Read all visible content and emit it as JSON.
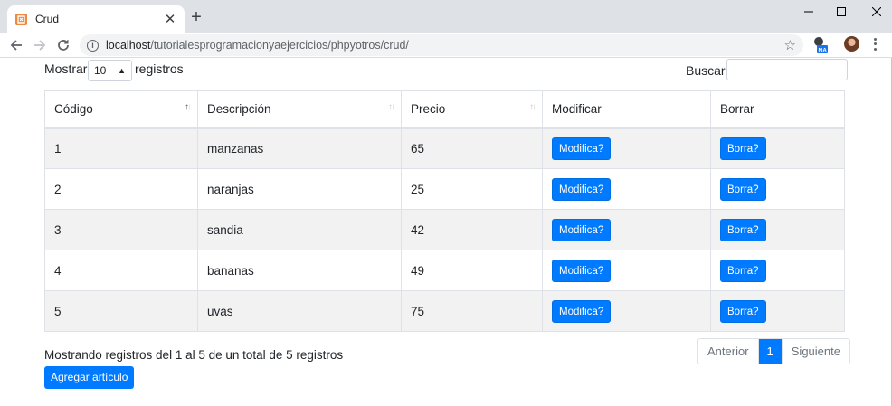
{
  "browser": {
    "tab_title": "Crud",
    "url_host": "localhost",
    "url_path": "/tutorialesprogramacionyaejercicios/phpyotros/crud/"
  },
  "colors": {
    "primary": "#007bff",
    "stripe": "#f2f2f2",
    "chrome": "#dee1e6"
  },
  "datatable": {
    "length_label_before": "Mostrar",
    "length_value": "10",
    "length_label_after": "registros",
    "search_label": "Buscar:",
    "search_value": "",
    "columns": [
      "Código",
      "Descripción",
      "Precio",
      "Modificar",
      "Borrar"
    ],
    "rows": [
      {
        "codigo": "1",
        "descripcion": "manzanas",
        "precio": "65",
        "modificar": "Modifica?",
        "borrar": "Borra?"
      },
      {
        "codigo": "2",
        "descripcion": "naranjas",
        "precio": "25",
        "modificar": "Modifica?",
        "borrar": "Borra?"
      },
      {
        "codigo": "3",
        "descripcion": "sandia",
        "precio": "42",
        "modificar": "Modifica?",
        "borrar": "Borra?"
      },
      {
        "codigo": "4",
        "descripcion": "bananas",
        "precio": "49",
        "modificar": "Modifica?",
        "borrar": "Borra?"
      },
      {
        "codigo": "5",
        "descripcion": "uvas",
        "precio": "75",
        "modificar": "Modifica?",
        "borrar": "Borra?"
      }
    ],
    "info": "Mostrando registros del 1 al 5 de un total de 5 registros",
    "pagination": {
      "previous": "Anterior",
      "current": "1",
      "next": "Siguiente"
    }
  },
  "add_button": "Agregar artículo"
}
